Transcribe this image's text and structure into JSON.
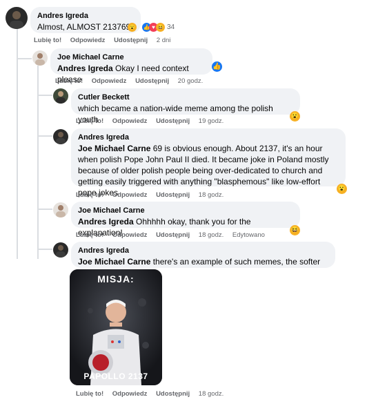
{
  "actions": {
    "like": "Lubię to!",
    "reply": "Odpowiedz",
    "share": "Udostępnij",
    "edited": "Edytowano"
  },
  "comments": [
    {
      "author": "Andres Igreda",
      "text": "Almost, ALMOST 213769",
      "reaction_count": "34",
      "time": "2 dni"
    },
    {
      "author": "Joe Michael Carne",
      "mention": "Andres Igreda",
      "text": " Okay I need context please",
      "time": "20 godz."
    },
    {
      "author": "Cutler Beckett",
      "text": "which became a nation-wide meme among the polish youth",
      "time": "19 godz."
    },
    {
      "author": "Andres Igreda",
      "mention": "Joe Michael Carne",
      "text": " 69 is obvious enough. About 2137, it's an hour when polish Pope John Paul II died. It became joke in Poland mostly because of older polish people being over-dedicated to church and getting easily triggered with anything \"blasphemous\" like low-effort pope jokes",
      "time": "18 godz."
    },
    {
      "author": "Joe Michael Carne",
      "mention": "Andres Igreda",
      "text": " Ohhhhh okay, thank you for the explanation!",
      "time": "18 godz."
    },
    {
      "author": "Andres Igreda",
      "mention": "Joe Michael Carne",
      "text": " there's an example of such memes, the softer one",
      "time": "18 godz."
    }
  ],
  "meme": {
    "top_text": "MISJA:",
    "bottom_text": "PAPOLLO 2137"
  },
  "colors": {
    "like_blue": "#1877f2",
    "love_red": "#f33e58",
    "haha_yellow": "#f7b125",
    "bubble_bg": "#f0f2f5",
    "meta_gray": "#65676b"
  },
  "icons": {
    "like": "thumbs-up-icon",
    "love": "heart-icon",
    "haha": "laughing-face-icon",
    "wow": "wow-face-icon"
  }
}
